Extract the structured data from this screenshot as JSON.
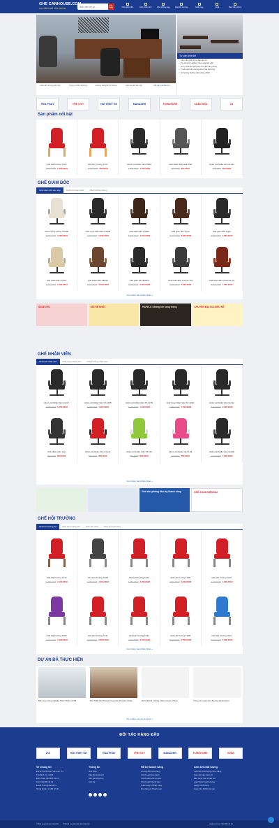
{
  "header": {
    "logo_main": "GHE CANHOUSE.COM",
    "logo_sub": "CHUYÊN GHẾ VĂN PHÒNG",
    "search_placeholder": "Bạn cần tìm gì...",
    "nav": [
      "Ghế giám đốc",
      "Ghế nhân viên",
      "Ghế phòng họp",
      "Ghế hội trường",
      "Ghế xoay",
      "Sofa",
      "Bàn văn phòng"
    ]
  },
  "banner": {
    "thumbs": [
      "Giám đốc phòng giám đốc",
      "Trang trí thiết kế phòng",
      "Công ty bàn ghế hội trường",
      "Các loại ghế cao cấp",
      "Mẫu ghế nổi bật mới"
    ]
  },
  "right_panel": {
    "title": "Tư vấn thiết kế",
    "items": [
      "Các mẫu ghế phòng đẹp giá tốt",
      "Tư vấn kinh nghiệm chọn mua bàn ghế",
      "Gợi ý chất liệu phổ biến cho ghế văn phòng",
      "5 mẫu ghế văn phòng Hòa Phát bán chạy",
      "Xu hướng thiết kế văn phòng 2018"
    ]
  },
  "partners_top": [
    "HÒA PHÁT",
    "THE CITY",
    "HỘI THIẾT KẾ",
    "MANAGER",
    "FURNITURE",
    "XUÂN HÒA",
    "V&"
  ],
  "featured": {
    "title": "Sản phẩm nổi bật",
    "items": [
      {
        "name": "Ghế Hội Trường TC03",
        "old": "1.500.000đ",
        "price": "1.350.000đ"
      },
      {
        "name": "Ghế Hội Trường TC07",
        "old": "1.200.000đ",
        "price": "990.000đ"
      },
      {
        "name": "Ghế Lưới Nhân Viên NV02",
        "old": "1.500.000đ",
        "price": "1.290.000đ"
      },
      {
        "name": "Ghế Nhân Viên Hòa Phát",
        "old": "990.000đ",
        "price": "870.000đ"
      },
      {
        "name": "Ghế Lưới Nhân Viên GL112",
        "old": "620.000đ",
        "price": "560.000đ"
      }
    ]
  },
  "director": {
    "title": "GHẾ GIÁM ĐỐC",
    "tabs": [
      "Ghế Giám đốc cao cấp",
      "Ghế lưới Giám Đốc",
      "Ghế trưởng phòng"
    ],
    "items": [
      {
        "name": "Ghế trưởng phòng GX308",
        "old": "3.590.000đ",
        "price": "3.150.000đ"
      },
      {
        "name": "Ghế Lưới Giám Đốc GT308",
        "old": "1.700.000đ",
        "price": "1.500.000đ"
      },
      {
        "name": "Ghế Giám đốc TQ086",
        "old": "5.500.000đ",
        "price": "4.200.000đ"
      },
      {
        "name": "Ghế giám đốc TQ12",
        "old": "3.200.000đ",
        "price": "2.900.000đ"
      },
      {
        "name": "Ghế giám đốc TQ01",
        "old": "3.000.000đ",
        "price": "2.800.000đ"
      },
      {
        "name": "Ghế Giám Đốc GT307",
        "old": "1.900.000đ",
        "price": "1.600.000đ"
      },
      {
        "name": "Ghế Giám Đốc GĐ612",
        "old": "3.900.000đ",
        "price": "3.500.000đ"
      },
      {
        "name": "Ghế giám đốc BG802",
        "old": "3.200.000đ",
        "price": "2.900.000đ"
      },
      {
        "name": "Ghế Giám Đốc Control-T01",
        "old": "6.500.000đ",
        "price": "5.500.000đ"
      },
      {
        "name": "Ghế Giám Đốc Chairman 01",
        "old": "8.900.000đ",
        "price": "7.600.000đ"
      }
    ],
    "more": "Xem thêm sản phẩm khác »"
  },
  "ads_1": [
    "SALE 20%",
    "GIÁ RẺ NHẤT",
    "HAFELE Không khí sang trọng",
    "KHUYẾN MẠI GIÁ SIÊU RẺ"
  ],
  "staff": {
    "title": "GHẾ NHÂN VIÊN",
    "tabs": [
      "Ghế lưới nhân viên",
      "Ghế xoay nhân viên",
      "Ghế Trưởng nhân viên"
    ],
    "items": [
      {
        "name": "Ghế Lưới Nhân Viên GL217",
        "old": "1.350.000đ",
        "price": "1.250.000đ"
      },
      {
        "name": "Ghế Lưới Nhân Viên ST-1058",
        "old": "1.350.000đ",
        "price": "1.200.000đ"
      },
      {
        "name": "Ghế Lưới Nhân Viên ST-117B",
        "old": "1.300.000đ",
        "price": "1.090.000đ"
      },
      {
        "name": "Ghế Xoay Nhân Viên ST-101D",
        "old": "1.650.000đ",
        "price": "1.500.000đ"
      },
      {
        "name": "Ghế Lưới Nhân Viên GL112",
        "old": "3.200.000đ",
        "price": "2.900.000đ"
      },
      {
        "name": "Ghế Nhân Viên Hòa",
        "old": "920.000đ",
        "price": "825.000đ"
      },
      {
        "name": "Ghế Lưới Nhân Viên ST-112",
        "old": "950.000đ",
        "price": "850.000đ"
      },
      {
        "name": "Ghế Lưới Nhân Viên ST-113",
        "old": "950.000đ",
        "price": "850.000đ"
      },
      {
        "name": "Ghế Lưới Nhân Viên T-03",
        "old": "700.000đ",
        "price": "650.000đ"
      },
      {
        "name": "Ghế Lưới Nhân Viên GL308",
        "old": "2.100.000đ",
        "price": "1.900.000đ"
      }
    ],
    "more": "Xem thêm sản phẩm khác »"
  },
  "ads_2": [
    "",
    "",
    "Ghế văn phòng đầu tay thanh công",
    "GHẾ XOAN HIỆN ĐẠI"
  ],
  "hall": {
    "title": "GHẾ HỘI TRƯỜNG",
    "tabs": [
      "Ghế hội trường TC",
      "Ghế hội trường NC",
      "Ghế sân chơi",
      "Ghế gỗ hộ trường"
    ],
    "items": [
      {
        "name": "Ghế Hội Trường TC12",
        "old": "2.300.000đ",
        "price": "2.100.000đ"
      },
      {
        "name": "Ghế Hội Trường TC08",
        "old": "1.300.000đ",
        "price": "1.000.000đ"
      },
      {
        "name": "Ghế Hội Trường TC03",
        "old": "2.500.000đ",
        "price": "2.200.000đ"
      },
      {
        "name": "Ghế Hội Trường TC06",
        "old": "2.500.000đ",
        "price": "2.200.000đ"
      },
      {
        "name": "Ghế Hội Trường TC07",
        "old": "2.100.000đ",
        "price": "1.900.000đ"
      },
      {
        "name": "Ghế Hội Trường TC09",
        "old": "2.300.000đ",
        "price": "1.900.000đ"
      },
      {
        "name": "Ghế Hội Trường TC11",
        "old": "3.200.000đ",
        "price": "2.800.000đ"
      },
      {
        "name": "Ghế Hội Trường TC04",
        "old": "2.800.000đ",
        "price": "2.500.000đ"
      },
      {
        "name": "Ghế Hội Trường TC05",
        "old": "5.000.000đ",
        "price": "4.500.000đ"
      },
      {
        "name": "Ghế Hội Trường TC10",
        "old": "2.300.000đ",
        "price": "2.000.000đ"
      }
    ],
    "more": "Xem thêm sản phẩm khác »"
  },
  "projects": {
    "title": "DỰ ÁN ĐÃ THỰC HIỆN",
    "items": [
      "Bàn Họp Công Nghiệp Thực Phẩm HCM",
      "Nội Thất Văn Phòng Trung tâm Khuyến Nông",
      "Nội thất hội trường Vietel Cream Plaza",
      "Trung tâm giáo dục Beemed Education"
    ],
    "more": "Xem thêm các dự án khác »"
  },
  "footer": {
    "title": "ĐỐI TÁC HÀNG ĐẦU",
    "partners": [
      "IFA",
      "HỘI THIẾT KẾ",
      "HÒA PHÁT",
      "THE CITY",
      "MANAGER",
      "FURNITURE",
      "XUÂN"
    ],
    "col1_title": "Về chúng tôi",
    "col1": [
      "Địa chỉ: 245 Phạm Văn Hai, P.5",
      "Tân Bình, Tp. HCM",
      "Điện thoại: 094 880 43 44",
      "Fax: 094 880 43 44",
      "Email: hotro@webdv.vn",
      "Số tài khoản: 0 185 07 00"
    ],
    "col2_title": "Thông tin",
    "col2": [
      "Giới thiệu",
      "Bảo đổi đường đi",
      "Bảo giá tổng hợp",
      "Liên hệ"
    ],
    "col3_title": "Hỗ trợ khách hàng",
    "col3": [
      "Hướng dẫn mua hàng",
      "Chính sách bảo hành",
      "Chính sách vận chuyển",
      "Chính sách thanh toán",
      "Giao hàng & Nhận hàng",
      "Mua hàng & Thanh toán"
    ],
    "col4_title": "Cam kết chất lượng",
    "col4": [
      "Cam kết chất lượng chính hãng",
      "Cam kết bảo hành tốt",
      "Bảo hành, bảo trì tận nơi",
      "Giao hàng nhanh chóng",
      "Hàng chính hãng",
      "Hoàn tiền 100% nếu sai"
    ],
    "copy": "© Bản quyền thuộc về HCG",
    "copy2": "Thiết kế và phát triển bởi Web Dv",
    "copy3": "Hotline hỗ trợ: 094 880 43 44"
  }
}
